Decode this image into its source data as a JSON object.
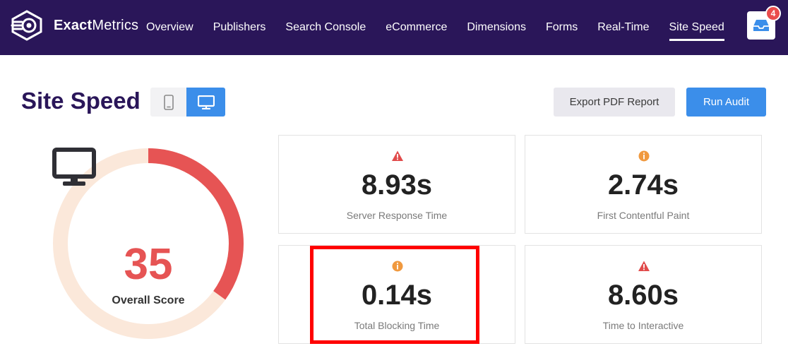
{
  "brand": {
    "name_bold": "Exact",
    "name_light": "Metrics",
    "logo_icon": "exactmetrics-logo-icon"
  },
  "nav": {
    "items": [
      {
        "label": "Overview"
      },
      {
        "label": "Publishers"
      },
      {
        "label": "Search Console"
      },
      {
        "label": "eCommerce"
      },
      {
        "label": "Dimensions"
      },
      {
        "label": "Forms"
      },
      {
        "label": "Real-Time"
      },
      {
        "label": "Site Speed",
        "active": true
      }
    ],
    "inbox_icon": "inbox-icon",
    "notification_count": "4"
  },
  "header": {
    "title": "Site Speed",
    "device_toggle": {
      "options": [
        "mobile",
        "desktop"
      ],
      "selected": "desktop"
    },
    "export_label": "Export PDF Report",
    "run_label": "Run Audit"
  },
  "score": {
    "value": "35",
    "label": "Overall Score",
    "fraction": 0.35,
    "icon": "monitor-icon"
  },
  "metrics": [
    {
      "value": "8.93s",
      "label": "Server Response Time",
      "status": "warning-triangle-icon"
    },
    {
      "value": "2.74s",
      "label": "First Contentful Paint",
      "status": "info-circle-icon"
    },
    {
      "value": "0.14s",
      "label": "Total Blocking Time",
      "status": "info-circle-icon"
    },
    {
      "value": "8.60s",
      "label": "Time to Interactive",
      "status": "warning-triangle-icon"
    }
  ],
  "colors": {
    "nav_bg": "#2a1659",
    "accent_blue": "#3b8eea",
    "score_red": "#e65454",
    "gauge_track": "#fbe8da",
    "warning_red": "#e14b4b",
    "info_orange": "#f0993f",
    "highlight": "#ff0000"
  }
}
